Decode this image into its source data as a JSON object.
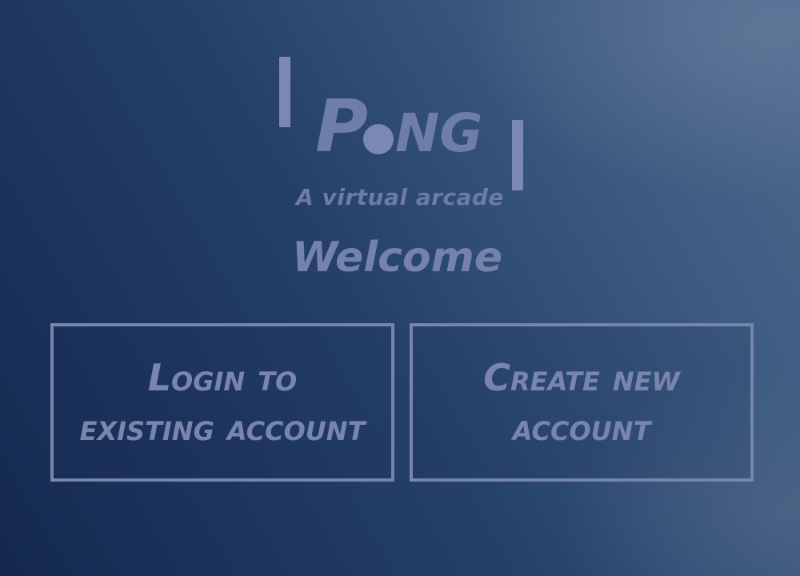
{
  "logo": {
    "letter_p": "P",
    "letters_ng": "NG",
    "subtitle": "A virtual arcade"
  },
  "welcome": "Welcome",
  "buttons": {
    "login": {
      "line1": "Login to",
      "line2": "existing account"
    },
    "create": {
      "line1": "Create new",
      "line2": "account"
    }
  },
  "colors": {
    "accent": "#7c88b4",
    "background_dark": "#14284f",
    "background_light": "#4d6a8e"
  }
}
